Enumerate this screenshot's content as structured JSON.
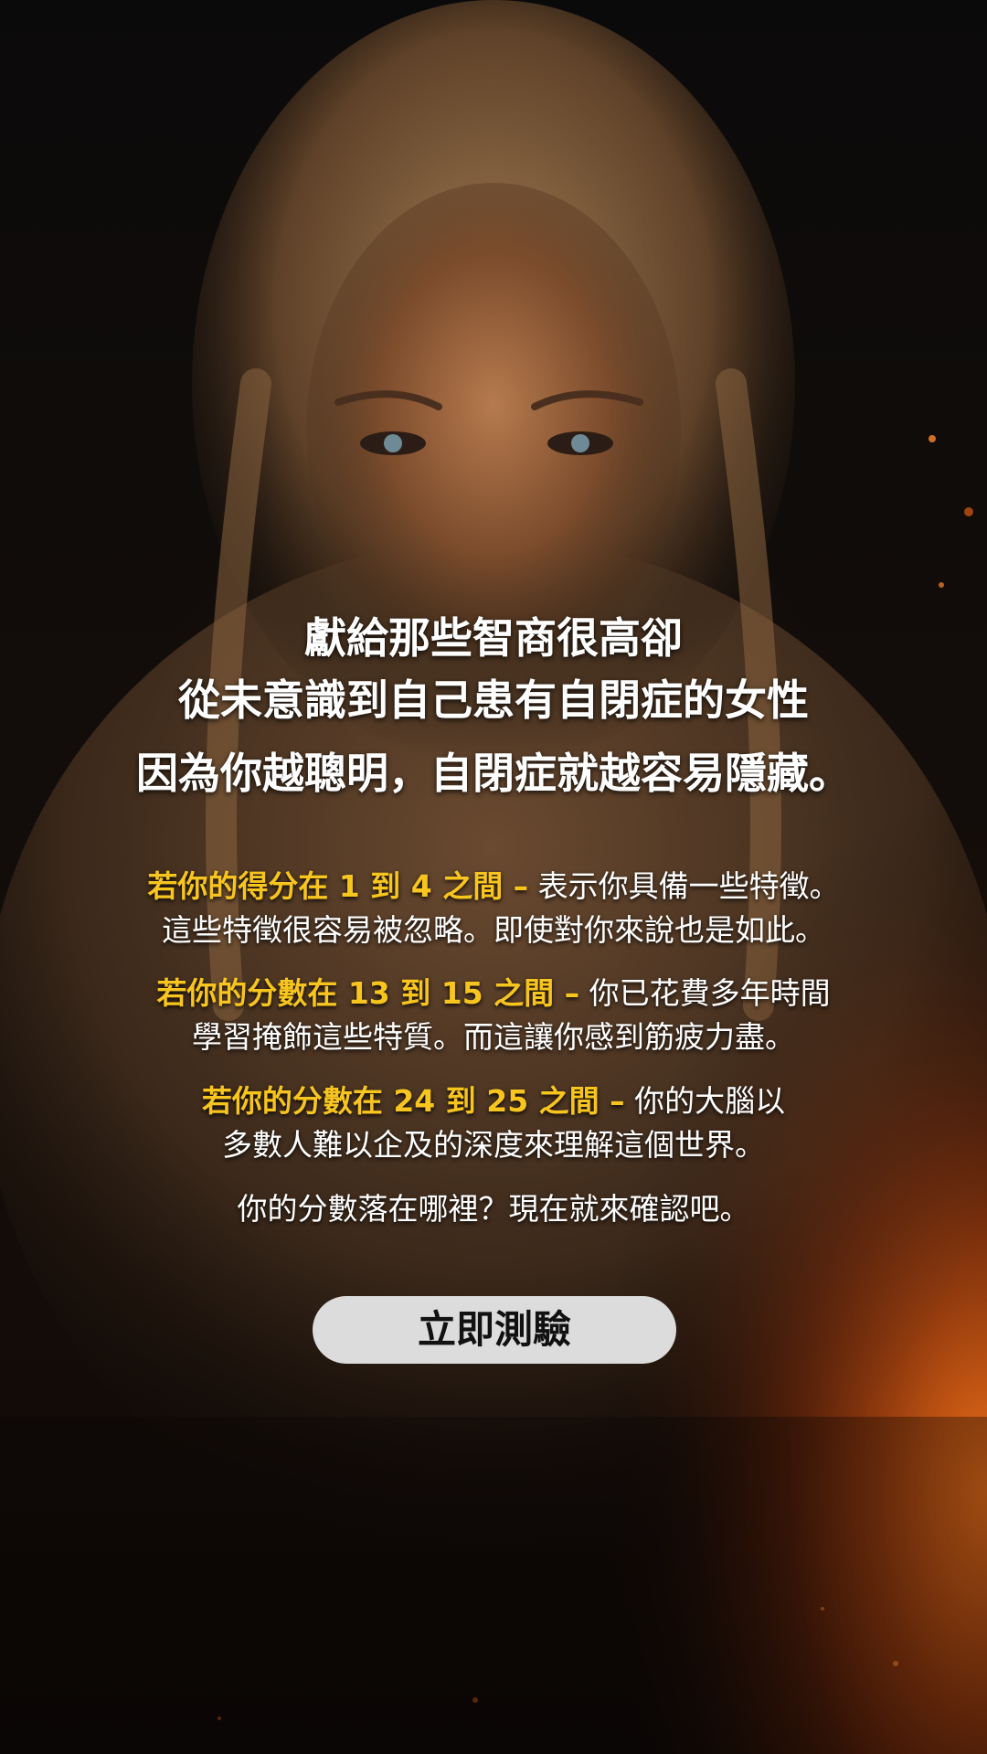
{
  "headline": {
    "line1": "獻給那些智商很高卻",
    "line2": "從未意識到自己患有自閉症的女性",
    "line3": "因為你越聰明，自閉症就越容易隱藏。"
  },
  "scores": [
    {
      "highlight": "若你的得分在 1 到 4 之間 –",
      "rest_line1": " 表示你具備一些特徵。",
      "line2": "這些特徵很容易被忽略。即使對你來說也是如此。"
    },
    {
      "highlight": "若你的分數在 13 到 15 之間 –",
      "rest_line1": " 你已花費多年時間",
      "line2": "學習掩飾這些特質。而這讓你感到筋疲力盡。"
    },
    {
      "highlight": "若你的分數在 24 到 25 之間 –",
      "rest_line1": " 你的大腦以",
      "line2": "多數人難以企及的深度來理解這個世界。"
    }
  ],
  "closing": "你的分數落在哪裡？現在就來確認吧。",
  "cta": {
    "label": "立即測驗"
  },
  "colors": {
    "highlight": "#f7c51e",
    "button_bg": "#dcdcdc",
    "text": "#ffffff"
  }
}
